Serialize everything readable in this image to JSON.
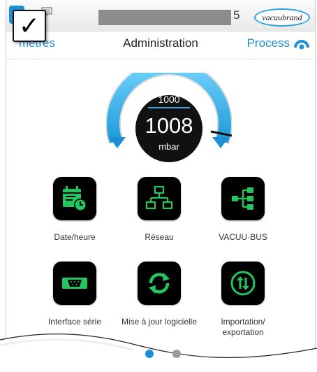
{
  "statusbar": {
    "serial_suffix": "5",
    "logo_text": "vacuubrand"
  },
  "checkbox": {
    "mark": "✓"
  },
  "navbar": {
    "left_label": "mètres",
    "title": "Administration",
    "right_label": "Process"
  },
  "gauge": {
    "setpoint": "1000",
    "value": "1008",
    "unit": "mbar"
  },
  "tiles": [
    {
      "label": "Date/heure",
      "icon": "calendar-clock-icon"
    },
    {
      "label": "Réseau",
      "icon": "network-icon"
    },
    {
      "label": "VACUU·BUS",
      "icon": "bus-tree-icon"
    },
    {
      "label": "Interface série",
      "icon": "serial-port-icon"
    },
    {
      "label": "Mise à jour logicielle",
      "icon": "refresh-icon"
    },
    {
      "label": "Importation/ exportation",
      "icon": "import-export-icon"
    }
  ],
  "pager": {
    "active": 1,
    "total": 2
  },
  "colors": {
    "accent": "#1e8fd6",
    "icon_green": "#22c55e",
    "gauge_blue": "#3ab3ee"
  }
}
